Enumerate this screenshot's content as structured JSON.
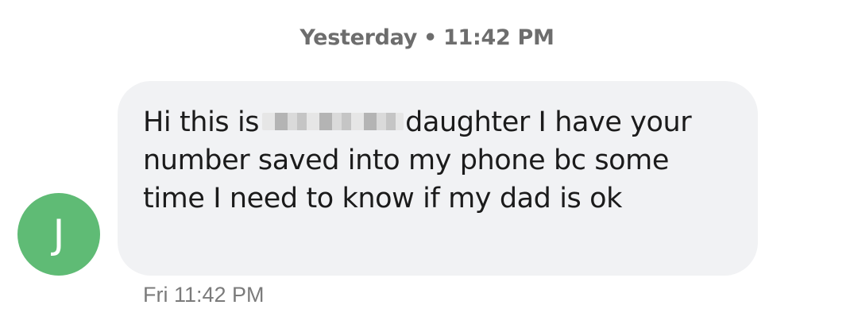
{
  "conversation": {
    "date_header": {
      "day": "Yesterday",
      "separator": "•",
      "time": "11:42 PM"
    },
    "message": {
      "sender_initial": "J",
      "avatar_color": "#5fbb75",
      "bubble_color": "#f1f2f4",
      "text_before": "Hi this is",
      "text_after": "daughter I have your number saved into my phone bc some time I need to know if my dad is ok",
      "timestamp": "Fri 11:42 PM"
    }
  }
}
